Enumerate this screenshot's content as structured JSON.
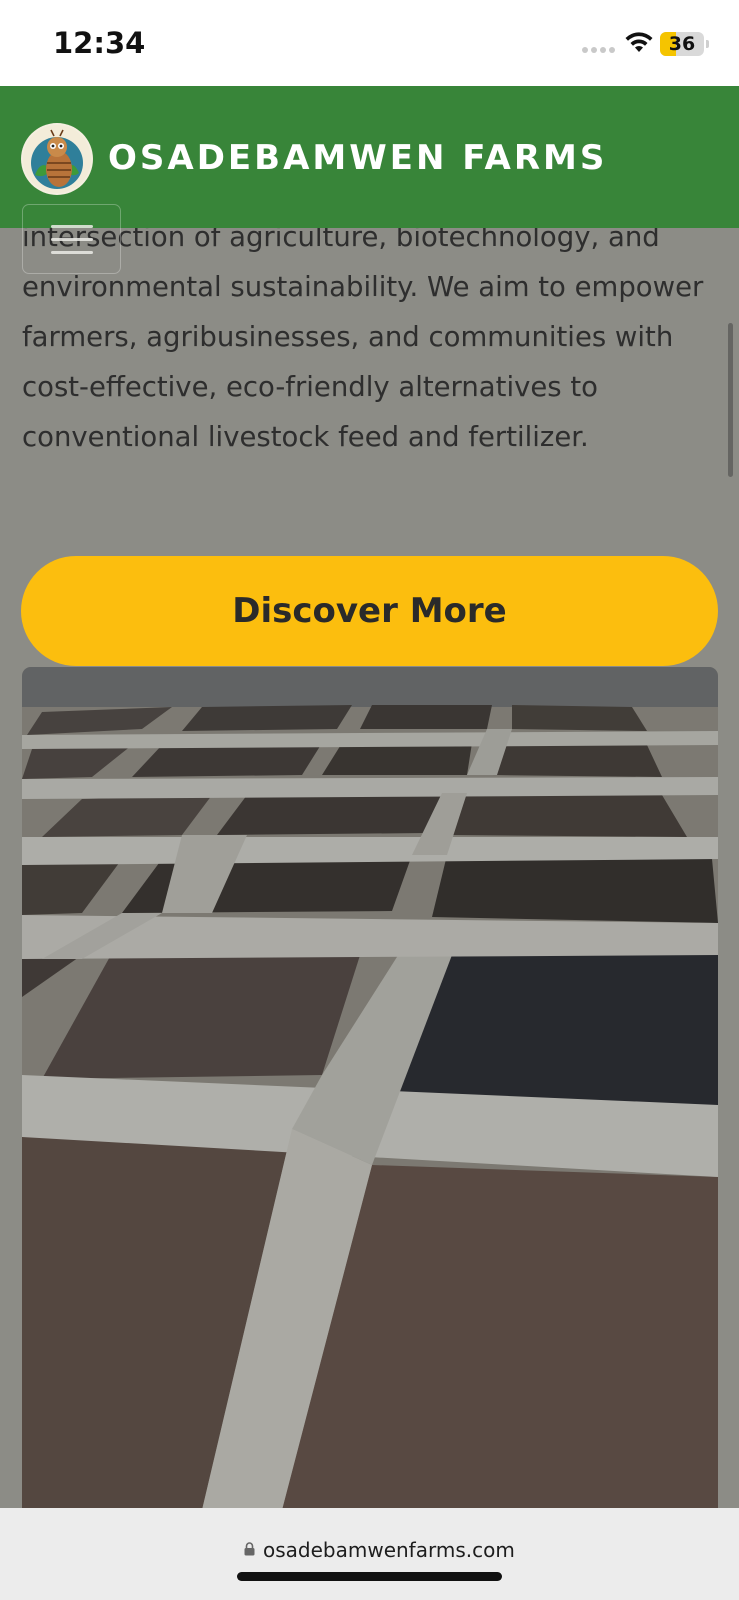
{
  "status_bar": {
    "time": "12:34",
    "battery_level": "36",
    "battery_fraction": 0.36,
    "icons": [
      "cellular-signal-icon",
      "wifi-icon",
      "battery-icon"
    ]
  },
  "header": {
    "title": "OSADEBAMWEN FARMS",
    "logo_icon": "larva-logo-icon",
    "menu_icon": "hamburger-menu-icon",
    "background_color": "#388539"
  },
  "content": {
    "paragraph": "intersection of agriculture, biotechnology, and environmental sustainability. We aim to empower farmers, agribusinesses, and communities with cost-effective, eco-friendly alternatives to conventional livestock feed and fertilizer.",
    "cta_label": "Discover More",
    "cta_color": "#fcbe0e"
  },
  "browser": {
    "url": "osadebamwenfarms.com",
    "lock_icon": "lock-icon"
  }
}
